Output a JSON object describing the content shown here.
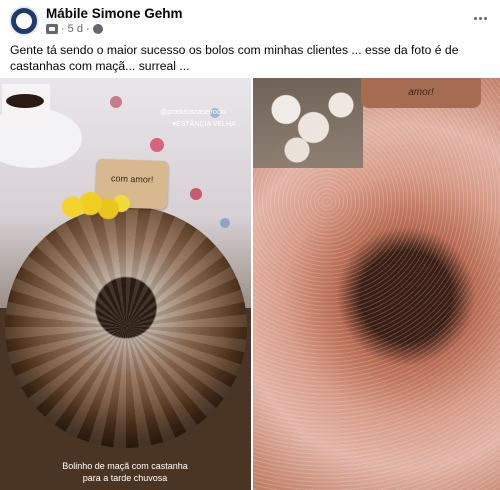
{
  "post": {
    "author": "Mábile Simone Gehm",
    "time": "5 d",
    "text": "Gente tá sendo o maior sucesso os bolos com minhas clientes ... esse da foto é de castanhas com maçã... surreal ..."
  },
  "photos": {
    "left": {
      "watermark_handle": "@produtoscaseirocio",
      "watermark_location": "♥ESTÂNCIA VELHA",
      "tag_text": "com amor!",
      "caption": "Bolinho de maçã com castanha para a tarde chuvosa"
    },
    "right": {
      "tag_text": "amor!"
    }
  },
  "icons": {
    "more": "more-options-icon",
    "privacy": "globe-icon",
    "audience": "messenger-icon"
  },
  "colors": {
    "text": "#050505",
    "secondary_text": "#65676b",
    "background": "#ffffff"
  }
}
